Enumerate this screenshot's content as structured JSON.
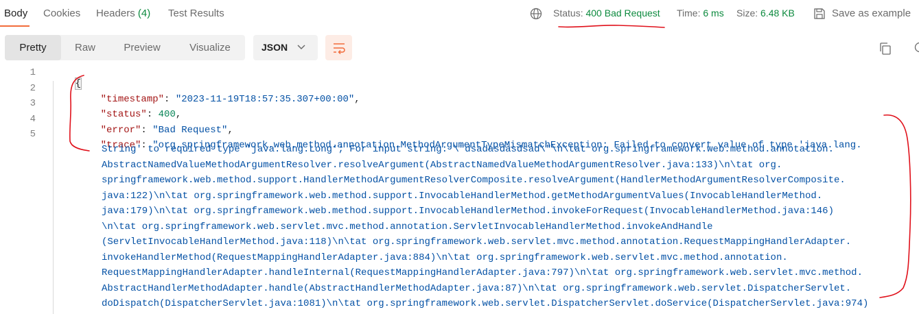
{
  "tabs": [
    {
      "label": "Body"
    },
    {
      "label": "Cookies"
    },
    {
      "label": "Headers",
      "count": "(4)"
    },
    {
      "label": "Test Results"
    }
  ],
  "status": {
    "status_label": "Status:",
    "status_value": "400 Bad Request",
    "time_label": "Time:",
    "time_value": "6 ms",
    "size_label": "Size:",
    "size_value": "6.48 KB",
    "save_label": "Save as example"
  },
  "view_modes": [
    "Pretty",
    "Raw",
    "Preview",
    "Visualize"
  ],
  "format": {
    "selected": "JSON"
  },
  "colors": {
    "accent": "#f26b3a",
    "success": "#0c8a3e",
    "annotation": "#e0101a"
  },
  "icons": [
    "globe-icon",
    "save-icon",
    "chevron-down-icon",
    "wrap-lines-icon",
    "copy-icon",
    "search-icon"
  ],
  "editor": {
    "line_numbers": [
      "1",
      "2",
      "3",
      "4",
      "5"
    ],
    "open_brace": "{",
    "line2": {
      "key": "\"timestamp\"",
      "sep": ": ",
      "value": "\"2023-11-19T18:57:35.307+00:00\"",
      "end": ","
    },
    "line3": {
      "key": "\"status\"",
      "sep": ": ",
      "value": "400",
      "end": ","
    },
    "line4": {
      "key": "\"error\"",
      "sep": ": ",
      "value": "\"Bad Request\"",
      "end": ","
    },
    "line5": {
      "key": "\"trace\"",
      "sep": ": ",
      "value": "\"org.springframework.web.method.annotation.MethodArgumentTypeMismatchException: Failed to convert value of type 'java.lang."
    },
    "trace_wrapped": [
      "String' to required type 'java.lang.Long'; For input string: \\\"dsadasdasdsad\\\"\\n\\tat org.springframework.web.method.annotation.",
      "AbstractNamedValueMethodArgumentResolver.resolveArgument(AbstractNamedValueMethodArgumentResolver.java:133)\\n\\tat org.",
      "springframework.web.method.support.HandlerMethodArgumentResolverComposite.resolveArgument(HandlerMethodArgumentResolverComposite.",
      "java:122)\\n\\tat org.springframework.web.method.support.InvocableHandlerMethod.getMethodArgumentValues(InvocableHandlerMethod.",
      "java:179)\\n\\tat org.springframework.web.method.support.InvocableHandlerMethod.invokeForRequest(InvocableHandlerMethod.java:146)",
      "\\n\\tat org.springframework.web.servlet.mvc.method.annotation.ServletInvocableHandlerMethod.invokeAndHandle",
      "(ServletInvocableHandlerMethod.java:118)\\n\\tat org.springframework.web.servlet.mvc.method.annotation.RequestMappingHandlerAdapter.",
      "invokeHandlerMethod(RequestMappingHandlerAdapter.java:884)\\n\\tat org.springframework.web.servlet.mvc.method.annotation.",
      "RequestMappingHandlerAdapter.handleInternal(RequestMappingHandlerAdapter.java:797)\\n\\tat org.springframework.web.servlet.mvc.method.",
      "AbstractHandlerMethodAdapter.handle(AbstractHandlerMethodAdapter.java:87)\\n\\tat org.springframework.web.servlet.DispatcherServlet.",
      "doDispatch(DispatcherServlet.java:1081)\\n\\tat org.springframework.web.servlet.DispatcherServlet.doService(DispatcherServlet.java:974)"
    ]
  }
}
